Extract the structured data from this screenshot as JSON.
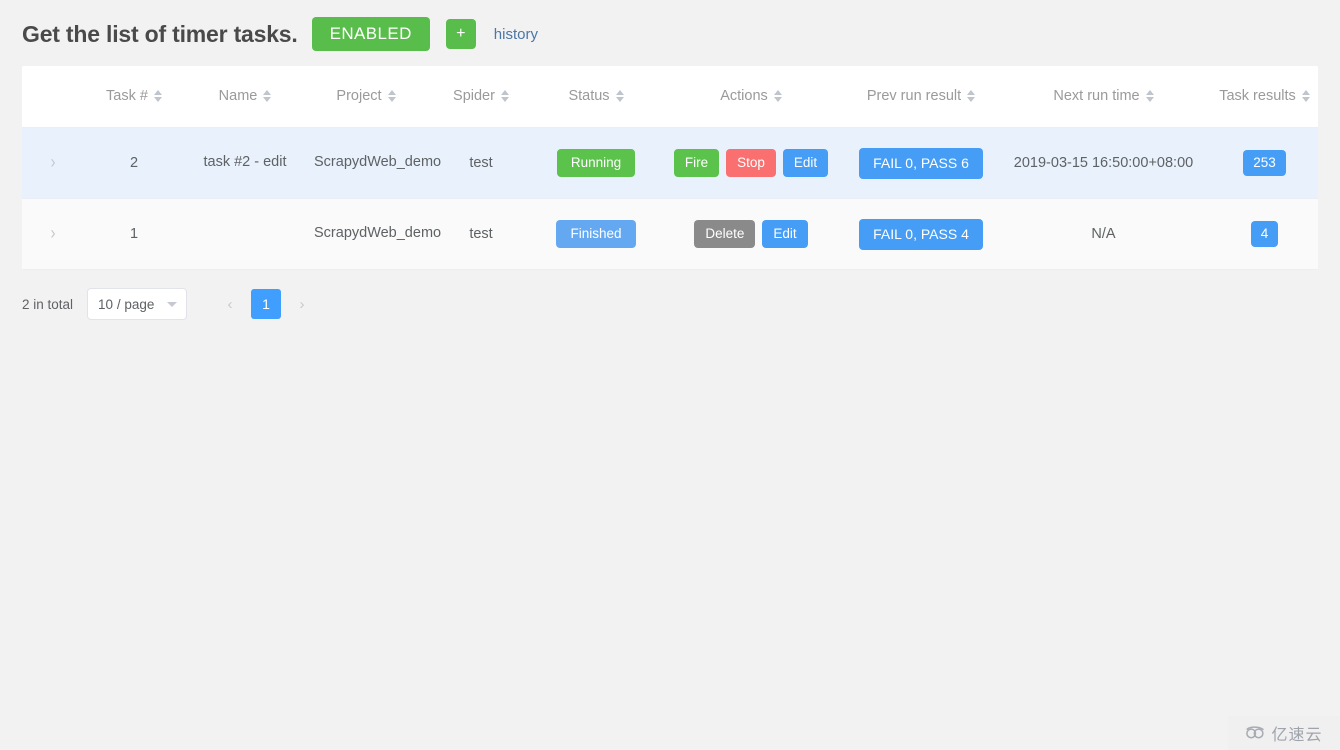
{
  "header": {
    "title": "Get the list of timer tasks.",
    "enabled_label": "ENABLED",
    "add_label": "+",
    "history_label": "history"
  },
  "table": {
    "columns": [
      {
        "key": "expand",
        "label": ""
      },
      {
        "key": "task_no",
        "label": "Task #"
      },
      {
        "key": "name",
        "label": "Name"
      },
      {
        "key": "project",
        "label": "Project"
      },
      {
        "key": "spider",
        "label": "Spider"
      },
      {
        "key": "status",
        "label": "Status"
      },
      {
        "key": "actions",
        "label": "Actions"
      },
      {
        "key": "prev_run_result",
        "label": "Prev run result"
      },
      {
        "key": "next_run_time",
        "label": "Next run time"
      },
      {
        "key": "task_results",
        "label": "Task results"
      }
    ],
    "rows": [
      {
        "expand_icon": "chevron-right-icon",
        "task_no": "2",
        "name": "task #2 - edit",
        "project": "ScrapydWeb_demo",
        "spider": "test",
        "status": "Running",
        "status_color": "#5bc24b",
        "actions": [
          {
            "label": "Fire",
            "color": "green"
          },
          {
            "label": "Stop",
            "color": "red"
          },
          {
            "label": "Edit",
            "color": "blue"
          }
        ],
        "prev_run_result": "FAIL 0, PASS 6",
        "next_run_time": "2019-03-15 16:50:00+08:00",
        "task_results": "253"
      },
      {
        "expand_icon": "chevron-right-icon",
        "task_no": "1",
        "name": "",
        "project": "ScrapydWeb_demo",
        "spider": "test",
        "status": "Finished",
        "status_color": "#64a8f2",
        "actions": [
          {
            "label": "Delete",
            "color": "gray"
          },
          {
            "label": "Edit",
            "color": "blue"
          }
        ],
        "prev_run_result": "FAIL 0, PASS 4",
        "next_run_time": "N/A",
        "task_results": "4"
      }
    ]
  },
  "pagination": {
    "total_label": "2 in total",
    "page_size_label": "10 / page",
    "prev_label": "‹",
    "next_label": "›",
    "current_page": "1"
  },
  "watermark": {
    "text": "亿速云"
  },
  "colors": {
    "accent_blue": "#409eff",
    "success_green": "#5bc24b",
    "danger_red": "#fa6f6f",
    "neutral_gray": "#8a8a8a",
    "row_highlight": "#e9f2fc",
    "page_background": "#f2f2f2"
  }
}
